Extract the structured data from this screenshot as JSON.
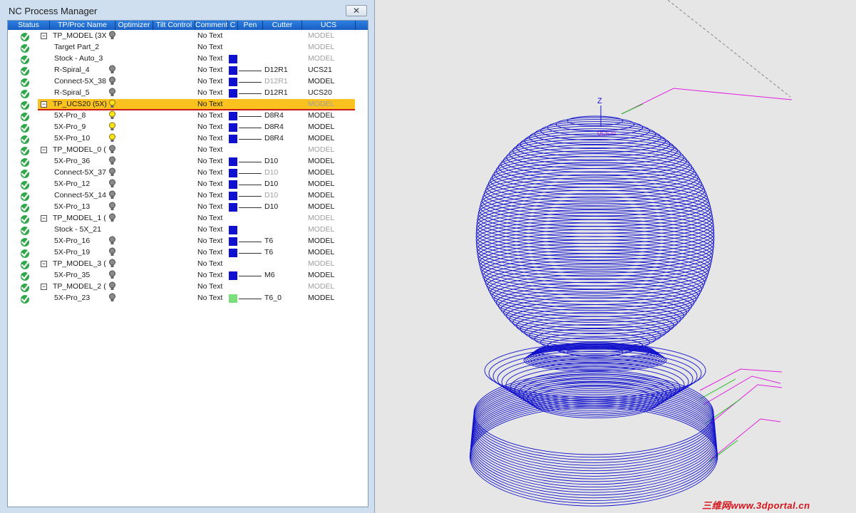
{
  "window": {
    "title": "NC Process Manager",
    "close_glyph": "✕"
  },
  "columns": [
    {
      "key": "status",
      "label": "Status"
    },
    {
      "key": "name",
      "label": "TP/Proc Name"
    },
    {
      "key": "optimizer",
      "label": "Optimizer"
    },
    {
      "key": "tilt",
      "label": "Tilt Control"
    },
    {
      "key": "comment",
      "label": "Comment"
    },
    {
      "key": "c",
      "label": "C"
    },
    {
      "key": "pen",
      "label": "Pen"
    },
    {
      "key": "cutter",
      "label": "Cutter"
    },
    {
      "key": "ucs",
      "label": "UCS"
    }
  ],
  "rows": [
    {
      "indent": 0,
      "tree": true,
      "name": "TP_MODEL (3X",
      "bulb": "grey",
      "comment": "No Text",
      "swatch": null,
      "cutter": "",
      "cutter_grey": false,
      "ucs": "MODEL",
      "ucs_grey": true
    },
    {
      "indent": 1,
      "tree": false,
      "name": "Target Part_2",
      "bulb": null,
      "comment": "No Text",
      "swatch": null,
      "cutter": "",
      "cutter_grey": false,
      "ucs": "MODEL",
      "ucs_grey": true
    },
    {
      "indent": 1,
      "tree": false,
      "name": "Stock - Auto_3",
      "bulb": null,
      "comment": "No Text",
      "swatch": "#1010d0",
      "pen": false,
      "cutter": "",
      "cutter_grey": false,
      "ucs": "MODEL",
      "ucs_grey": true
    },
    {
      "indent": 1,
      "tree": false,
      "name": "R-Spiral_4",
      "bulb": "grey",
      "comment": "No Text",
      "swatch": "#1010d0",
      "pen": true,
      "cutter": "D12R1",
      "cutter_grey": false,
      "ucs": "UCS21",
      "ucs_grey": false
    },
    {
      "indent": 1,
      "tree": false,
      "name": "Connect-5X_38",
      "bulb": "grey",
      "comment": "No Text",
      "swatch": "#1010d0",
      "pen": true,
      "cutter": "D12R1",
      "cutter_grey": true,
      "ucs": "MODEL",
      "ucs_grey": false
    },
    {
      "indent": 1,
      "tree": false,
      "name": "R-Spiral_5",
      "bulb": "grey",
      "comment": "No Text",
      "swatch": "#1010d0",
      "pen": true,
      "cutter": "D12R1",
      "cutter_grey": false,
      "ucs": "UCS20",
      "ucs_grey": false
    },
    {
      "indent": 0,
      "tree": true,
      "name": "TP_UCS20 (5X)",
      "bulb": "yellow",
      "comment": "No Text",
      "swatch": null,
      "cutter": "",
      "cutter_grey": false,
      "ucs": "MODEL",
      "ucs_grey": true,
      "selected": true
    },
    {
      "indent": 1,
      "tree": false,
      "name": "5X-Pro_8",
      "bulb": "yellow",
      "comment": "No Text",
      "swatch": "#1010d0",
      "pen": true,
      "cutter": "D8R4",
      "cutter_grey": false,
      "ucs": "MODEL",
      "ucs_grey": false
    },
    {
      "indent": 1,
      "tree": false,
      "name": "5X-Pro_9",
      "bulb": "yellow",
      "comment": "No Text",
      "swatch": "#1010d0",
      "pen": true,
      "cutter": "D8R4",
      "cutter_grey": false,
      "ucs": "MODEL",
      "ucs_grey": false
    },
    {
      "indent": 1,
      "tree": false,
      "name": "5X-Pro_10",
      "bulb": "yellow",
      "comment": "No Text",
      "swatch": "#1010d0",
      "pen": true,
      "cutter": "D8R4",
      "cutter_grey": false,
      "ucs": "MODEL",
      "ucs_grey": false
    },
    {
      "indent": 0,
      "tree": true,
      "name": "TP_MODEL_0 (",
      "bulb": "grey",
      "comment": "No Text",
      "swatch": null,
      "cutter": "",
      "cutter_grey": false,
      "ucs": "MODEL",
      "ucs_grey": true
    },
    {
      "indent": 1,
      "tree": false,
      "name": "5X-Pro_36",
      "bulb": "grey",
      "comment": "No Text",
      "swatch": "#1010d0",
      "pen": true,
      "cutter": "D10",
      "cutter_grey": false,
      "ucs": "MODEL",
      "ucs_grey": false
    },
    {
      "indent": 1,
      "tree": false,
      "name": "Connect-5X_37",
      "bulb": "grey",
      "comment": "No Text",
      "swatch": "#1010d0",
      "pen": true,
      "cutter": "D10",
      "cutter_grey": true,
      "ucs": "MODEL",
      "ucs_grey": false
    },
    {
      "indent": 1,
      "tree": false,
      "name": "5X-Pro_12",
      "bulb": "grey",
      "comment": "No Text",
      "swatch": "#1010d0",
      "pen": true,
      "cutter": "D10",
      "cutter_grey": false,
      "ucs": "MODEL",
      "ucs_grey": false
    },
    {
      "indent": 1,
      "tree": false,
      "name": "Connect-5X_14",
      "bulb": "grey",
      "comment": "No Text",
      "swatch": "#1010d0",
      "pen": true,
      "cutter": "D10",
      "cutter_grey": true,
      "ucs": "MODEL",
      "ucs_grey": false
    },
    {
      "indent": 1,
      "tree": false,
      "name": "5X-Pro_13",
      "bulb": "grey",
      "comment": "No Text",
      "swatch": "#1010d0",
      "pen": true,
      "cutter": "D10",
      "cutter_grey": false,
      "ucs": "MODEL",
      "ucs_grey": false
    },
    {
      "indent": 0,
      "tree": true,
      "name": "TP_MODEL_1 (",
      "bulb": "grey",
      "comment": "No Text",
      "swatch": null,
      "cutter": "",
      "cutter_grey": false,
      "ucs": "MODEL",
      "ucs_grey": true
    },
    {
      "indent": 1,
      "tree": false,
      "name": "Stock - 5X_21",
      "bulb": null,
      "comment": "No Text",
      "swatch": "#1010d0",
      "pen": false,
      "cutter": "",
      "cutter_grey": false,
      "ucs": "MODEL",
      "ucs_grey": true
    },
    {
      "indent": 1,
      "tree": false,
      "name": "5X-Pro_16",
      "bulb": "grey",
      "comment": "No Text",
      "swatch": "#1010d0",
      "pen": true,
      "cutter": "T6",
      "cutter_grey": false,
      "ucs": "MODEL",
      "ucs_grey": false
    },
    {
      "indent": 1,
      "tree": false,
      "name": "5X-Pro_19",
      "bulb": "grey",
      "comment": "No Text",
      "swatch": "#1010d0",
      "pen": true,
      "cutter": "T6",
      "cutter_grey": false,
      "ucs": "MODEL",
      "ucs_grey": false
    },
    {
      "indent": 0,
      "tree": true,
      "name": "TP_MODEL_3 (",
      "bulb": "grey",
      "comment": "No Text",
      "swatch": null,
      "cutter": "",
      "cutter_grey": false,
      "ucs": "MODEL",
      "ucs_grey": true
    },
    {
      "indent": 1,
      "tree": false,
      "name": "5X-Pro_35",
      "bulb": "grey",
      "comment": "No Text",
      "swatch": "#1010d0",
      "pen": true,
      "cutter": "M6",
      "cutter_grey": false,
      "ucs": "MODEL",
      "ucs_grey": false
    },
    {
      "indent": 0,
      "tree": true,
      "name": "TP_MODEL_2 (",
      "bulb": "grey",
      "comment": "No Text",
      "swatch": null,
      "cutter": "",
      "cutter_grey": false,
      "ucs": "MODEL",
      "ucs_grey": true
    },
    {
      "indent": 1,
      "tree": false,
      "name": "5X-Pro_23",
      "bulb": "grey",
      "comment": "No Text",
      "swatch": "#7be07b",
      "pen": true,
      "cutter": "T6_0",
      "cutter_grey": false,
      "ucs": "MODEL",
      "ucs_grey": false
    }
  ],
  "viewport": {
    "axis_label": "Z",
    "ucs_label": "UCS20",
    "toolpath_color": "#1111cc",
    "link_color": "#e020e0",
    "approach_color": "#20c020"
  },
  "watermark": "三维网www.3dportal.cn",
  "colors": {
    "header_blue": "#1a5fc4",
    "selected_row": "#f9c21f",
    "check_green": "#2fa84a"
  }
}
